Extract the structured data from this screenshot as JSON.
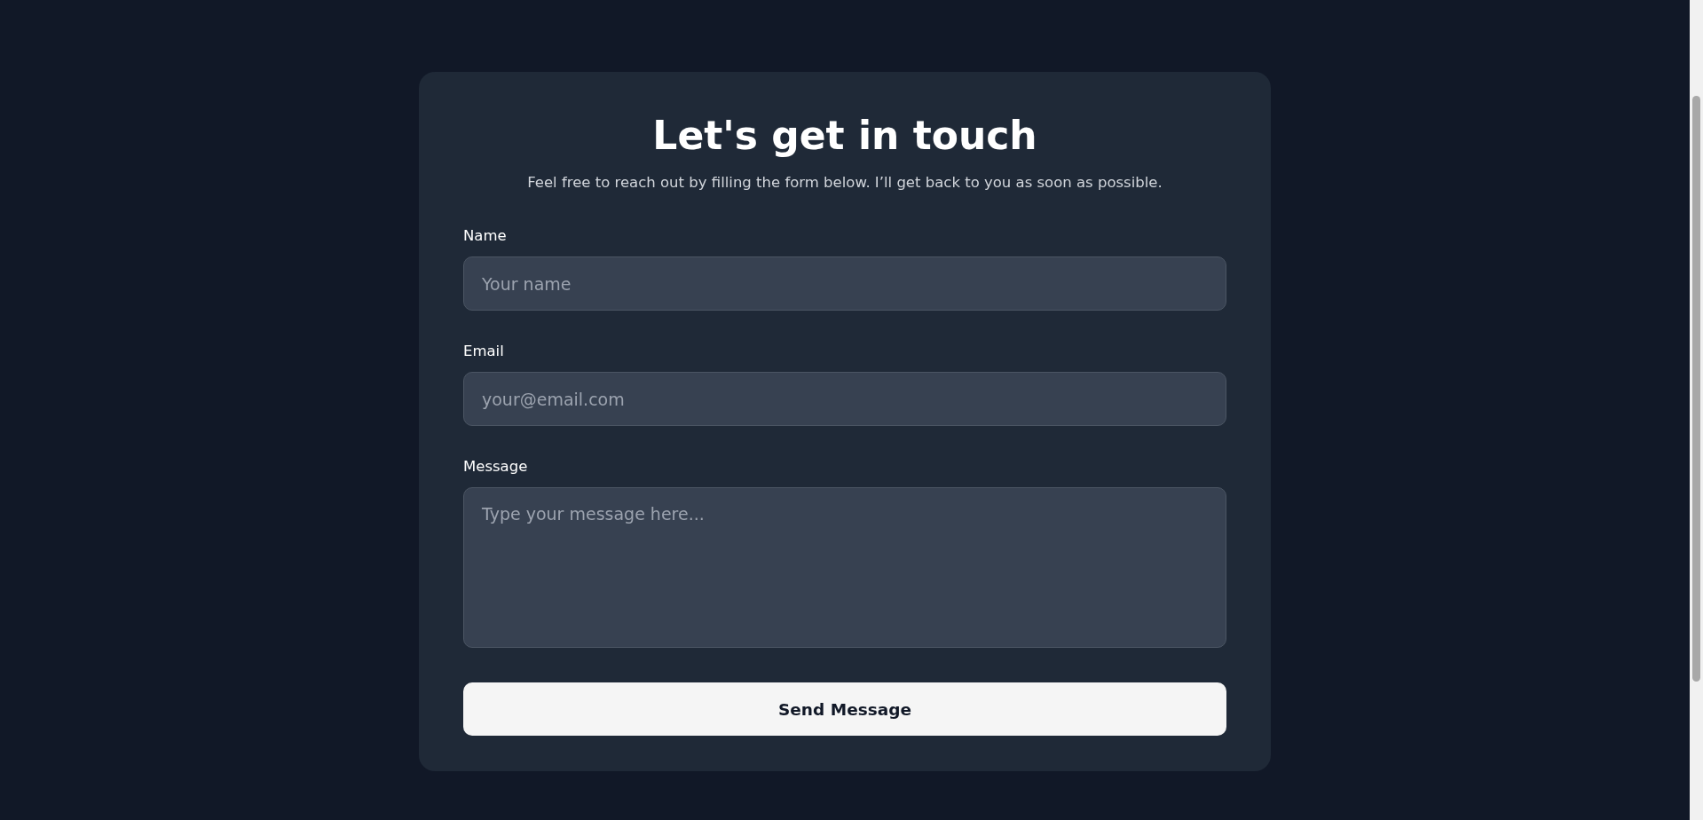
{
  "form": {
    "title": "Let's get in touch",
    "subtitle": "Feel free to reach out by filling the form below. I’ll get back to you as soon as possible.",
    "fields": [
      {
        "kind": "input",
        "label": "Name",
        "placeholder": "Your name"
      },
      {
        "kind": "input",
        "label": "Email",
        "placeholder": "your@email.com"
      },
      {
        "kind": "textarea",
        "label": "Message",
        "placeholder": "Type your message here..."
      }
    ],
    "submit": "Send Message"
  }
}
